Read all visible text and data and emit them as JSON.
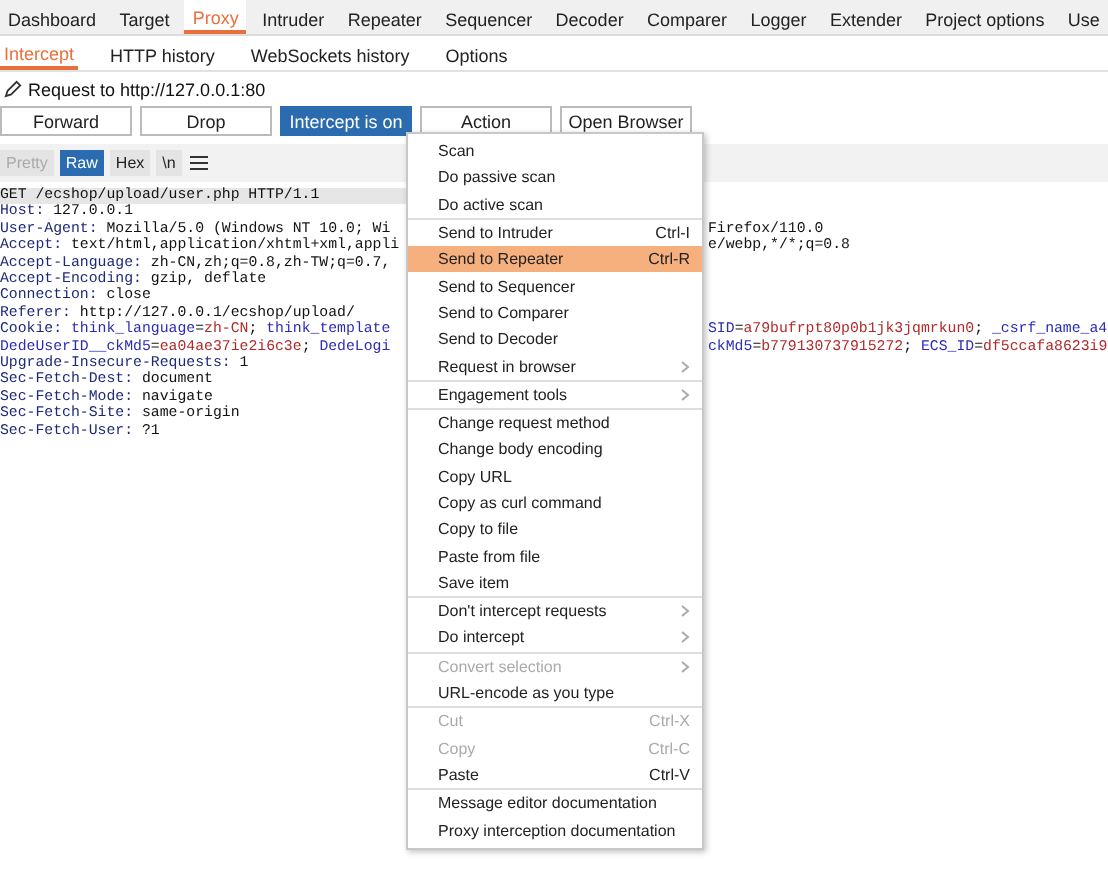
{
  "main_tabs": [
    {
      "label": "Dashboard",
      "selected": false
    },
    {
      "label": "Target",
      "selected": false
    },
    {
      "label": "Proxy",
      "selected": true
    },
    {
      "label": "Intruder",
      "selected": false
    },
    {
      "label": "Repeater",
      "selected": false
    },
    {
      "label": "Sequencer",
      "selected": false
    },
    {
      "label": "Decoder",
      "selected": false
    },
    {
      "label": "Comparer",
      "selected": false
    },
    {
      "label": "Logger",
      "selected": false
    },
    {
      "label": "Extender",
      "selected": false
    },
    {
      "label": "Project options",
      "selected": false
    },
    {
      "label": "Use",
      "selected": false
    }
  ],
  "sub_tabs": [
    {
      "label": "Intercept",
      "selected": true
    },
    {
      "label": "HTTP history",
      "selected": false
    },
    {
      "label": "WebSockets history",
      "selected": false
    },
    {
      "label": "Options",
      "selected": false
    }
  ],
  "request_label": "Request to http://127.0.0.1:80",
  "buttons": [
    {
      "label": "Forward",
      "selected": false
    },
    {
      "label": "Drop",
      "selected": false
    },
    {
      "label": "Intercept is on",
      "selected": true
    },
    {
      "label": "Action",
      "selected": false
    },
    {
      "label": "Open Browser",
      "selected": false
    }
  ],
  "view_modes": [
    {
      "label": "Pretty",
      "selected": false,
      "disabled": true
    },
    {
      "label": "Raw",
      "selected": true,
      "disabled": false
    },
    {
      "label": "Hex",
      "selected": false,
      "disabled": false
    },
    {
      "label": "\\n",
      "selected": false,
      "disabled": false
    }
  ],
  "request_lines": [
    {
      "left": [
        {
          "kind": "plain",
          "text": "GET /ecshop/upload/user.php HTTP/1.1"
        }
      ]
    },
    {
      "left": [
        {
          "kind": "key",
          "text": "Host:"
        },
        {
          "kind": "plain",
          "text": " 127.0.0.1"
        }
      ]
    },
    {
      "left": [
        {
          "kind": "key",
          "text": "User-Agent:"
        },
        {
          "kind": "plain",
          "text": " Mozilla/5.0 (Windows NT 10.0; Wi"
        }
      ],
      "right": [
        {
          "kind": "plain",
          "text": "Firefox/110.0"
        }
      ]
    },
    {
      "left": [
        {
          "kind": "key",
          "text": "Accept:"
        },
        {
          "kind": "plain",
          "text": " text/html,application/xhtml+xml,appli"
        }
      ],
      "right": [
        {
          "kind": "plain",
          "text": "e/webp,*/*;q=0.8"
        }
      ]
    },
    {
      "left": [
        {
          "kind": "key",
          "text": "Accept-Language:"
        },
        {
          "kind": "plain",
          "text": " zh-CN,zh;q=0.8,zh-TW;q=0.7,"
        }
      ]
    },
    {
      "left": [
        {
          "kind": "key",
          "text": "Accept-Encoding:"
        },
        {
          "kind": "plain",
          "text": " gzip, deflate"
        }
      ]
    },
    {
      "left": [
        {
          "kind": "key",
          "text": "Connection:"
        },
        {
          "kind": "plain",
          "text": " close"
        }
      ]
    },
    {
      "left": [
        {
          "kind": "key",
          "text": "Referer:"
        },
        {
          "kind": "plain",
          "text": " http://127.0.0.1/ecshop/upload/"
        }
      ]
    },
    {
      "left": [
        {
          "kind": "key",
          "text": "Cookie:"
        },
        {
          "kind": "cname",
          "text": " think_language"
        },
        {
          "kind": "plain",
          "text": "="
        },
        {
          "kind": "cvalue",
          "text": "zh-CN"
        },
        {
          "kind": "plain",
          "text": "; "
        },
        {
          "kind": "cname",
          "text": "think_template"
        }
      ],
      "right": [
        {
          "kind": "cname",
          "text": "SID"
        },
        {
          "kind": "plain",
          "text": "="
        },
        {
          "kind": "cvalue",
          "text": "a79bufrpt80p0b1jk3jqmrkun0"
        },
        {
          "kind": "plain",
          "text": "; "
        },
        {
          "kind": "cname",
          "text": "_csrf_name_a4"
        }
      ]
    },
    {
      "left": [
        {
          "kind": "cname",
          "text": "DedeUserID__ckMd5"
        },
        {
          "kind": "plain",
          "text": "="
        },
        {
          "kind": "cvalue",
          "text": "ea04ae37ie2i6c3e"
        },
        {
          "kind": "plain",
          "text": "; "
        },
        {
          "kind": "cname",
          "text": "DedeLogi"
        }
      ],
      "right": [
        {
          "kind": "cname",
          "text": "ckMd5"
        },
        {
          "kind": "plain",
          "text": "="
        },
        {
          "kind": "cvalue",
          "text": "b779130737915272"
        },
        {
          "kind": "plain",
          "text": "; "
        },
        {
          "kind": "cname",
          "text": "ECS_ID"
        },
        {
          "kind": "plain",
          "text": "="
        },
        {
          "kind": "cvalue",
          "text": "df5ccafa8623i9"
        }
      ]
    },
    {
      "left": [
        {
          "kind": "key",
          "text": "Upgrade-Insecure-Requests:"
        },
        {
          "kind": "plain",
          "text": " 1"
        }
      ]
    },
    {
      "left": [
        {
          "kind": "key",
          "text": "Sec-Fetch-Dest:"
        },
        {
          "kind": "plain",
          "text": " document"
        }
      ]
    },
    {
      "left": [
        {
          "kind": "key",
          "text": "Sec-Fetch-Mode:"
        },
        {
          "kind": "plain",
          "text": " navigate"
        }
      ]
    },
    {
      "left": [
        {
          "kind": "key",
          "text": "Sec-Fetch-Site:"
        },
        {
          "kind": "plain",
          "text": " same-origin"
        }
      ]
    },
    {
      "left": [
        {
          "kind": "key",
          "text": "Sec-Fetch-User:"
        },
        {
          "kind": "plain",
          "text": " ?1"
        }
      ]
    }
  ],
  "action_menu": [
    [
      {
        "label": "Scan",
        "selected": false,
        "disabled": false,
        "submenu": false
      },
      {
        "label": "Do passive scan",
        "selected": false,
        "disabled": false,
        "submenu": false
      },
      {
        "label": "Do active scan",
        "selected": false,
        "disabled": false,
        "submenu": false
      }
    ],
    [
      {
        "label": "Send to Intruder",
        "shortcut": "Ctrl-I",
        "selected": false,
        "disabled": false,
        "submenu": false
      },
      {
        "label": "Send to Repeater",
        "shortcut": "Ctrl-R",
        "selected": true,
        "disabled": false,
        "submenu": false
      },
      {
        "label": "Send to Sequencer",
        "selected": false,
        "disabled": false,
        "submenu": false
      },
      {
        "label": "Send to Comparer",
        "selected": false,
        "disabled": false,
        "submenu": false
      },
      {
        "label": "Send to Decoder",
        "selected": false,
        "disabled": false,
        "submenu": false
      },
      {
        "label": "Request in browser",
        "selected": false,
        "disabled": false,
        "submenu": true
      }
    ],
    [
      {
        "label": "Engagement tools",
        "selected": false,
        "disabled": false,
        "submenu": true
      }
    ],
    [
      {
        "label": "Change request method",
        "selected": false,
        "disabled": false,
        "submenu": false
      },
      {
        "label": "Change body encoding",
        "selected": false,
        "disabled": false,
        "submenu": false
      },
      {
        "label": "Copy URL",
        "selected": false,
        "disabled": false,
        "submenu": false
      },
      {
        "label": "Copy as curl command",
        "selected": false,
        "disabled": false,
        "submenu": false
      },
      {
        "label": "Copy to file",
        "selected": false,
        "disabled": false,
        "submenu": false
      },
      {
        "label": "Paste from file",
        "selected": false,
        "disabled": false,
        "submenu": false
      },
      {
        "label": "Save item",
        "selected": false,
        "disabled": false,
        "submenu": false
      }
    ],
    [
      {
        "label": "Don't intercept requests",
        "selected": false,
        "disabled": false,
        "submenu": true
      },
      {
        "label": "Do intercept",
        "selected": false,
        "disabled": false,
        "submenu": true
      }
    ],
    [
      {
        "label": "Convert selection",
        "selected": false,
        "disabled": true,
        "submenu": true
      },
      {
        "label": "URL-encode as you type",
        "selected": false,
        "disabled": false,
        "submenu": false
      }
    ],
    [
      {
        "label": "Cut",
        "shortcut": "Ctrl-X",
        "selected": false,
        "disabled": true,
        "submenu": false
      },
      {
        "label": "Copy",
        "shortcut": "Ctrl-C",
        "selected": false,
        "disabled": true,
        "submenu": false
      },
      {
        "label": "Paste",
        "shortcut": "Ctrl-V",
        "selected": false,
        "disabled": false,
        "submenu": false
      }
    ],
    [
      {
        "label": "Message editor documentation",
        "selected": false,
        "disabled": false,
        "submenu": false
      },
      {
        "label": "Proxy interception documentation",
        "selected": false,
        "disabled": false,
        "submenu": false
      }
    ]
  ]
}
